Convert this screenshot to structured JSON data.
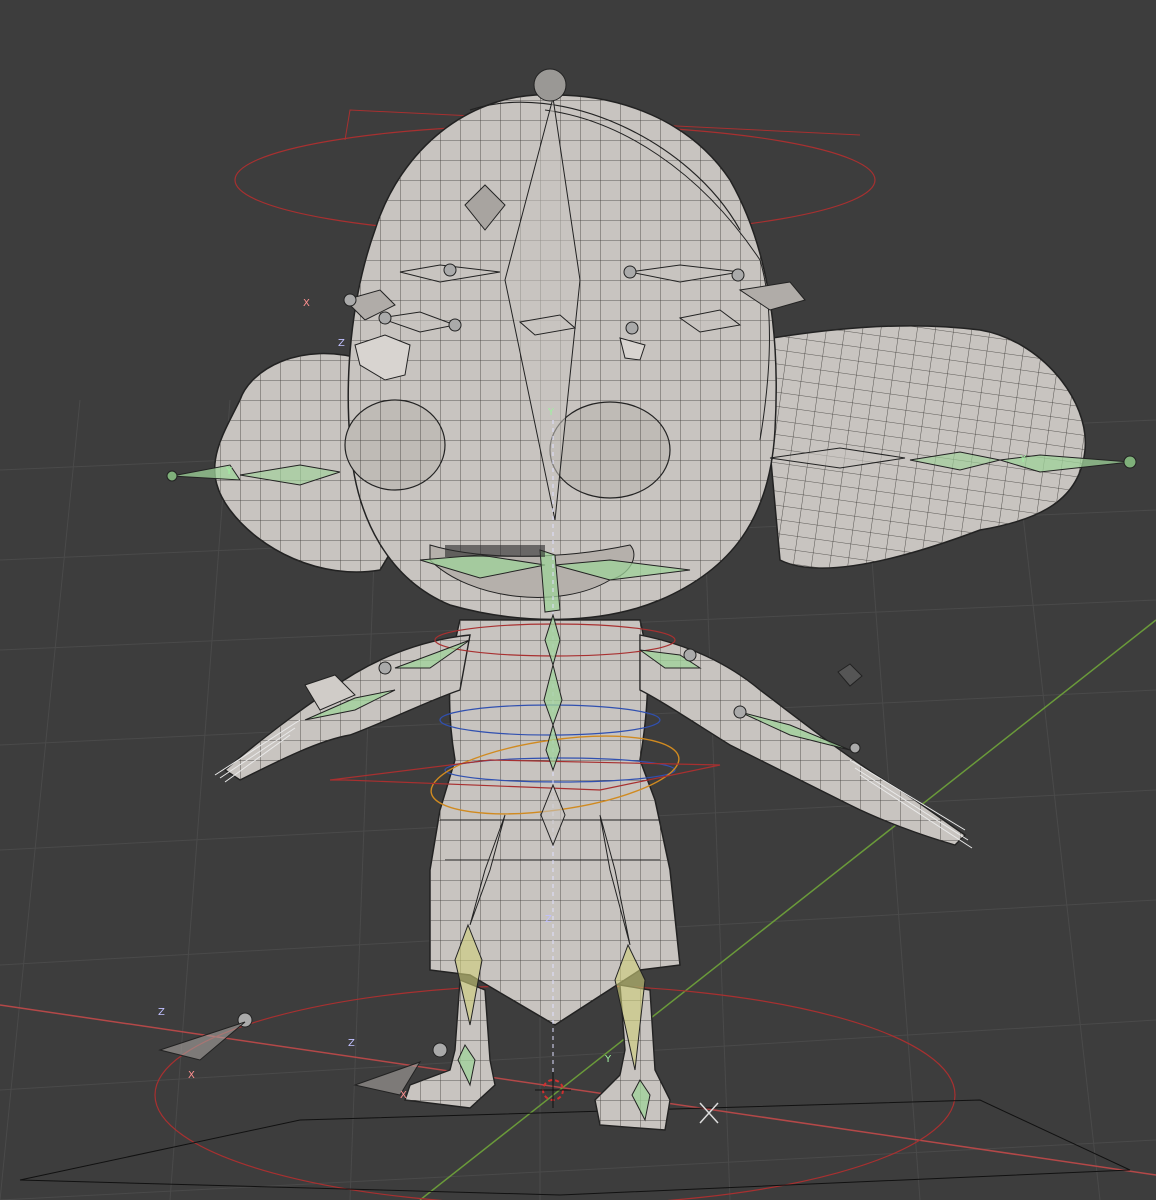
{
  "viewport": {
    "background": "#3d3d3d",
    "grid_color": "#4a4a4a",
    "x_axis_color": "#b44848",
    "y_axis_color": "#6a9a3a",
    "mesh_color": "#c8c4c0",
    "mesh_wire_color": "#2a2a2a",
    "bone_color": "#9fd39a",
    "bone_yellow": "#cfcf7a",
    "empty_color": "#000000",
    "controller_red": "#a83030",
    "controller_blue": "#3050b0",
    "controller_orange": "#d08a20"
  },
  "axis_letters": {
    "x": "X",
    "y": "Y",
    "z": "Z"
  },
  "icons": {
    "cursor": "3d-cursor-icon",
    "light": "light-icon"
  }
}
